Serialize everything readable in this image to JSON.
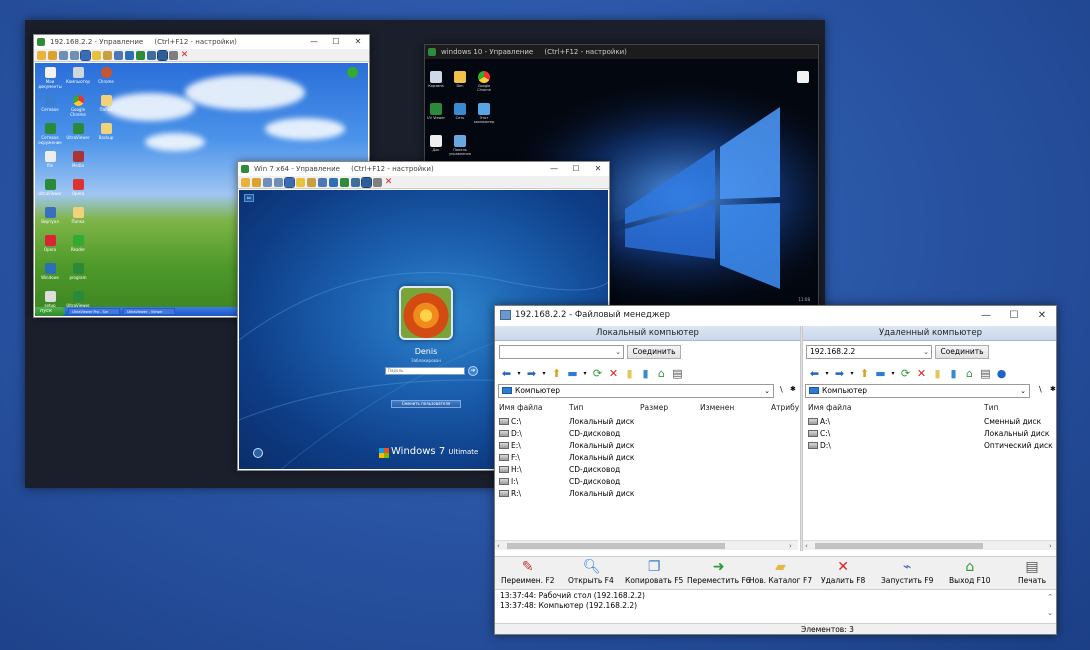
{
  "xp_window": {
    "title": "192.168.2.2 - Управление",
    "hint": "(Ctrl+F12 - настройки)",
    "taskbar": {
      "start": "пуск",
      "tasks": [
        "UltraViewer Pro - Ser",
        "UltraViewer - Viewer"
      ]
    }
  },
  "w10_window": {
    "title": "windows 10 - Управление",
    "hint": "(Ctrl+F12 - настройки)",
    "clock": "11:08"
  },
  "w7_window": {
    "title": "Win 7 x64 - Управление",
    "hint": "(Ctrl+F12 - настройки)",
    "user_name": "Denis",
    "user_subtitle": "Заблокирован",
    "password_placeholder": "Пароль",
    "switch_user": "Сменить пользователя",
    "brand": "Windows 7",
    "edition": "Ultimate"
  },
  "file_manager": {
    "title": "192.168.2.2 - Файловый менеджер",
    "local": {
      "header": "Локальный компьютер",
      "address": "",
      "connect": "Соединить",
      "path": "Компьютер",
      "columns": [
        "Имя файла",
        "Тип",
        "Размер",
        "Изменен",
        "Атрибу"
      ],
      "rows": [
        {
          "name": "C:\\",
          "type": "Локальный диск"
        },
        {
          "name": "D:\\",
          "type": "CD-дисковод"
        },
        {
          "name": "E:\\",
          "type": "Локальный диск"
        },
        {
          "name": "F:\\",
          "type": "Локальный диск"
        },
        {
          "name": "H:\\",
          "type": "CD-дисковод"
        },
        {
          "name": "I:\\",
          "type": "CD-дисковод"
        },
        {
          "name": "R:\\",
          "type": "Локальный диск"
        }
      ]
    },
    "remote": {
      "header": "Удаленный компьютер",
      "address": "192.168.2.2",
      "connect": "Соединить",
      "path": "Компьютер",
      "columns": [
        "Имя файла",
        "Тип"
      ],
      "rows": [
        {
          "name": "A:\\",
          "type": "Сменный диск"
        },
        {
          "name": "C:\\",
          "type": "Локальный диск"
        },
        {
          "name": "D:\\",
          "type": "Оптический диск"
        }
      ]
    },
    "fkeys": [
      {
        "label": "Переимен. F2",
        "icon": "pencil-icon"
      },
      {
        "label": "Открыть F4",
        "icon": "open-icon"
      },
      {
        "label": "Копировать F5",
        "icon": "copy-icon"
      },
      {
        "label": "Переместить F6",
        "icon": "move-icon"
      },
      {
        "label": "Нов. Каталог F7",
        "icon": "folder-icon"
      },
      {
        "label": "Удалить F8",
        "icon": "delete-icon"
      },
      {
        "label": "Запустить F9",
        "icon": "run-icon"
      },
      {
        "label": "Выход F10",
        "icon": "exit-icon"
      },
      {
        "label": "Печать",
        "icon": "print-icon"
      }
    ],
    "log": [
      "13:37:44: Рабочий стол  (192.168.2.2)",
      "13:37:48: Компьютер  (192.168.2.2)"
    ],
    "status": "Элементов: 3"
  }
}
